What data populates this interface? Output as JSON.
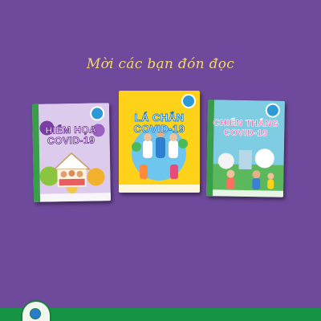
{
  "headline": "Mời các bạn đón đọc",
  "books": [
    {
      "title_line1": "HIỂM HỌA",
      "title_line2": "COVID-19",
      "cover_color": "#d8c7e8",
      "title_color": "#ffffff",
      "title_stroke": "#6a2f8f",
      "spine_color": "#3a9d4a"
    },
    {
      "title_line1": "LÁ CHẮN",
      "title_line2": "COVID-19",
      "cover_color": "#ffd21a",
      "title_color": "#ffffff",
      "title_stroke": "#1f7fd0",
      "spine_color": "#3a9d4a"
    },
    {
      "title_line1": "CHIẾN THẮNG",
      "title_line2": "COVID-19",
      "cover_color": "#7fcde3",
      "title_color": "#ff4fa1",
      "title_stroke": "#ffffff",
      "spine_color": "#3a9d4a"
    }
  ],
  "colors": {
    "background": "#6f4a9c",
    "headline": "#f4d96a",
    "footer": "#149444"
  },
  "icons": {
    "footer_logo": "publisher-logo-icon",
    "badge": "series-badge-icon"
  }
}
